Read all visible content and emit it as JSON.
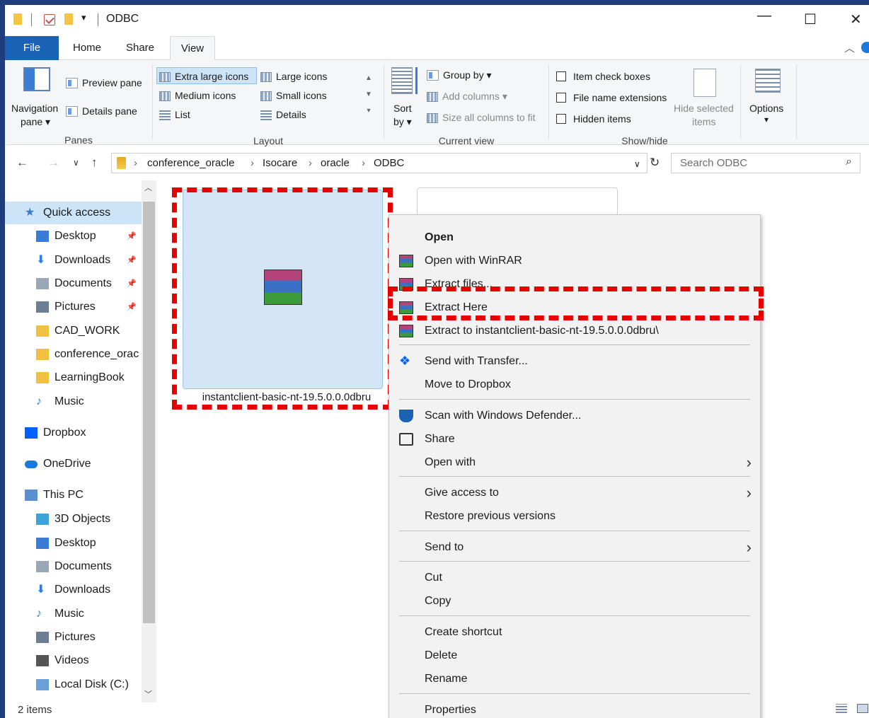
{
  "window": {
    "title": "ODBC"
  },
  "window_controls": {
    "minimize": "—",
    "maximize": "☐",
    "close": "✕"
  },
  "tabs": [
    {
      "label": "File"
    },
    {
      "label": "Home"
    },
    {
      "label": "Share"
    },
    {
      "label": "View"
    }
  ],
  "ribbon": {
    "panes": {
      "navigation_pane": "Navigation",
      "navigation_pane_2": "pane ▾",
      "preview_pane": "Preview pane",
      "details_pane": "Details pane",
      "group": "Panes"
    },
    "layout": {
      "items": [
        "Extra large icons",
        "Large icons",
        "Medium icons",
        "Small icons",
        "List",
        "Details"
      ],
      "selected": "Extra large icons",
      "group": "Layout"
    },
    "current_view": {
      "sort_by": "Sort",
      "sort_by_2": "by ▾",
      "group_by": "Group by ▾",
      "add_columns": "Add columns ▾",
      "size_all_columns": "Size all columns to fit",
      "group": "Current view"
    },
    "show_hide": {
      "item_check_boxes": "Item check boxes",
      "file_name_extensions": "File name extensions",
      "hidden_items": "Hidden items",
      "hide_selected": "Hide selected",
      "hide_selected_2": "items",
      "group": "Show/hide"
    },
    "options": {
      "label": "Options",
      "label_2": "▾"
    }
  },
  "address_bar": {
    "crumbs": [
      "conference_oracle",
      "Isocare",
      "oracle",
      "ODBC"
    ],
    "search_placeholder": "Search ODBC"
  },
  "nav": {
    "items": [
      {
        "label": "Quick access",
        "icon": "star-icon"
      },
      {
        "label": "Desktop",
        "icon": "desktop-icon"
      },
      {
        "label": "Downloads",
        "icon": "download-icon"
      },
      {
        "label": "Documents",
        "icon": "documents-icon"
      },
      {
        "label": "Pictures",
        "icon": "pictures-icon"
      },
      {
        "label": "CAD_WORK",
        "icon": "folder-icon"
      },
      {
        "label": "conference_orac",
        "icon": "folder-icon"
      },
      {
        "label": "LearningBook",
        "icon": "folder-icon"
      },
      {
        "label": "Music",
        "icon": "music-icon"
      },
      {
        "label": "Dropbox",
        "icon": "dropbox-icon"
      },
      {
        "label": "OneDrive",
        "icon": "cloud-icon"
      },
      {
        "label": "This PC",
        "icon": "pc-icon"
      },
      {
        "label": "3D Objects",
        "icon": "cube-icon"
      },
      {
        "label": "Desktop",
        "icon": "desktop-icon"
      },
      {
        "label": "Documents",
        "icon": "documents-icon"
      },
      {
        "label": "Downloads",
        "icon": "download-icon"
      },
      {
        "label": "Music",
        "icon": "music-icon"
      },
      {
        "label": "Pictures",
        "icon": "pictures-icon"
      },
      {
        "label": "Videos",
        "icon": "video-icon"
      },
      {
        "label": "Local Disk (C:)",
        "icon": "disk-icon"
      }
    ]
  },
  "file": {
    "name": "instantclient-basic-nt-19.5.0.0.0dbru"
  },
  "context_menu": {
    "items": [
      {
        "label": "Open"
      },
      {
        "label": "Open with WinRAR"
      },
      {
        "label": "Extract files..."
      },
      {
        "label": "Extract Here"
      },
      {
        "label": "Extract to instantclient-basic-nt-19.5.0.0.0dbru\\"
      },
      {
        "label": "Send with Transfer..."
      },
      {
        "label": "Move to Dropbox"
      },
      {
        "label": "Scan with Windows Defender..."
      },
      {
        "label": "Share"
      },
      {
        "label": "Open with"
      },
      {
        "label": "Give access to"
      },
      {
        "label": "Restore previous versions"
      },
      {
        "label": "Send to"
      },
      {
        "label": "Cut"
      },
      {
        "label": "Copy"
      },
      {
        "label": "Create shortcut"
      },
      {
        "label": "Delete"
      },
      {
        "label": "Rename"
      },
      {
        "label": "Properties"
      }
    ],
    "highlighted": "Extract Here"
  },
  "status_bar": {
    "item_count": "2 items"
  },
  "colors": {
    "accent": "#1a62b3",
    "highlight": "#e80000",
    "selection": "#cce4f7"
  }
}
